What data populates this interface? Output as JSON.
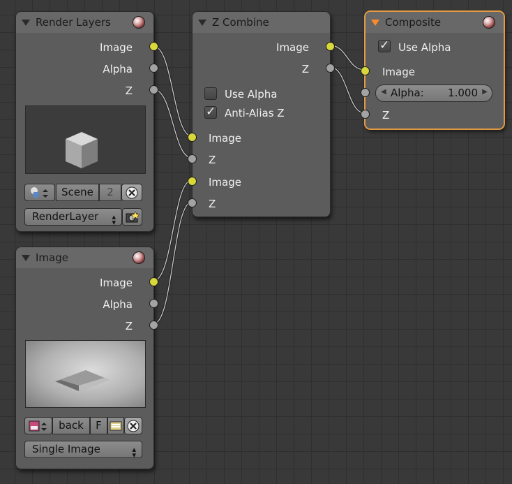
{
  "nodes": {
    "render_layers": {
      "title": "Render Layers",
      "outputs": [
        "Image",
        "Alpha",
        "Z"
      ],
      "scene_label": "Scene",
      "scene_users": "2",
      "layer_select": "RenderLayer"
    },
    "z_combine": {
      "title": "Z Combine",
      "outputs": [
        "Image",
        "Z"
      ],
      "use_alpha_label": "Use Alpha",
      "use_alpha_checked": false,
      "anti_alias_label": "Anti-Alias Z",
      "anti_alias_checked": true,
      "inputs": [
        "Image",
        "Z",
        "Image",
        "Z"
      ]
    },
    "composite": {
      "title": "Composite",
      "use_alpha_label": "Use Alpha",
      "use_alpha_checked": true,
      "inputs": [
        "Image",
        "Z"
      ],
      "alpha_label": "Alpha:",
      "alpha_value": "1.000"
    },
    "image": {
      "title": "Image",
      "outputs": [
        "Image",
        "Alpha",
        "Z"
      ],
      "image_name": "back",
      "fake_user": "F",
      "source_select": "Single Image"
    }
  },
  "colors": {
    "background": "#393939",
    "node_body": "#5c5c5c",
    "socket_color": "#d8d83b",
    "socket_value": "#a3a3a3",
    "active_border": "#e39a43"
  },
  "icons": {
    "close": "close-icon",
    "node_collapse": "triangle-down-icon",
    "preview_toggle": "sphere-preview-icon",
    "render_camera": "camera-icon",
    "open_file": "folder-icon"
  }
}
